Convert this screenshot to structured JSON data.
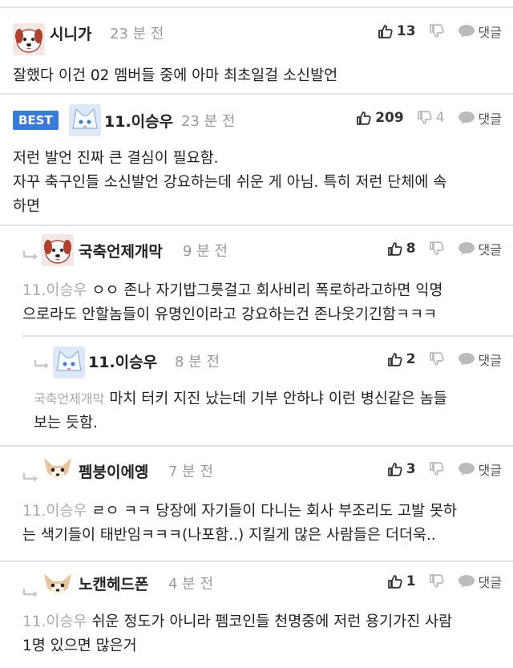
{
  "comments": [
    {
      "nick": "시니가",
      "time": "23 분 전",
      "likes": "13",
      "dislikes": "",
      "reply_label": "댓글",
      "text": "잘했다 이건 02 멤버들 중에 아마 최초일걸 소신발언"
    },
    {
      "badge": "BEST",
      "nick": "11.이승우",
      "time": "23 분 전",
      "likes": "209",
      "dislikes": "4",
      "reply_label": "댓글",
      "text_line1": "저런 발언 진짜 큰 결심이 필요함.",
      "text_line2": "자꾸 축구인들 소신발언 강요하는데 쉬운 게 아님. 특히 저런 단체에 속",
      "text_line3": "하면"
    },
    {
      "nick": "국축언제개막",
      "time": "9 분 전",
      "likes": "8",
      "dislikes": "",
      "reply_label": "댓글",
      "mention": "11.이승우",
      "text_line1": "ㅇㅇ 존나 자기밥그릇걸고 회사비리 폭로하라고하면 익명",
      "text_line2": "으로라도 안할놈들이 유명인이라고 강요하는건 존나웃기긴함ㅋㅋㅋ"
    },
    {
      "nick": "11.이승우",
      "time": "8 분 전",
      "likes": "2",
      "dislikes": "",
      "reply_label": "댓글",
      "mention": "국축언제개막",
      "text_line1": "마치 터키 지진 났는데 기부 안하냐 이런 병신같은 놈들",
      "text_line2": "보는 듯함."
    },
    {
      "nick": "펨붕이에옝",
      "time": "7 분 전",
      "likes": "3",
      "dislikes": "",
      "reply_label": "댓글",
      "mention": "11.이승우",
      "text_line1": "ㄹㅇ ㅋㅋ 당장에 자기들이 다니는 회사 부조리도 고발 못하",
      "text_line2": "는 색기들이 태반임ㅋㅋㅋ(나포함..) 지킬게 많은 사람들은 더더욱.."
    },
    {
      "nick": "노캔헤드폰",
      "time": "4 분 전",
      "likes": "1",
      "dislikes": "",
      "reply_label": "댓글",
      "mention": "11.이승우",
      "text_line1": "쉬운 정도가 아니라 펨코인들 천명중에 저런 용기가진 사람",
      "text_line2": "1명 있으면 많은거"
    }
  ],
  "colors": {
    "best_badge": "#3a7ad8",
    "mention": "#aaaaaa",
    "time": "#9a9a9a"
  },
  "icons": [
    "thumb-up-icon",
    "thumb-down-icon",
    "speech-bubble-icon",
    "reply-arrow-icon",
    "avatar-dog-icon",
    "avatar-cat-icon",
    "avatar-chihuahua-icon"
  ]
}
